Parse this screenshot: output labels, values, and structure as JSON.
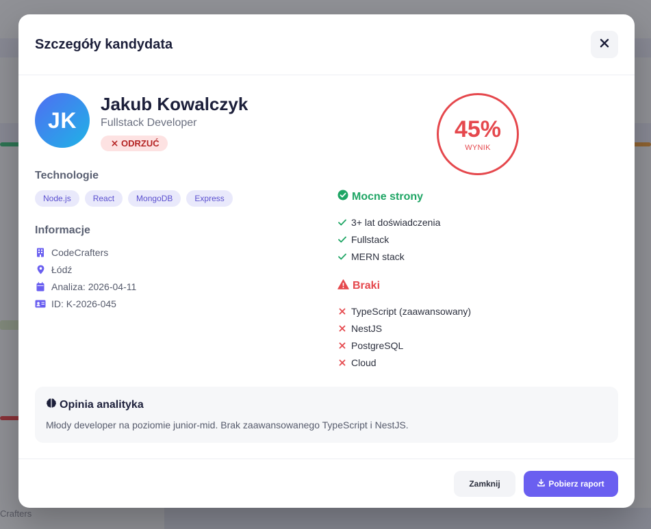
{
  "background": {
    "hint_texts": [
      "Crafters"
    ]
  },
  "modal": {
    "title": "Szczegóły kandydata",
    "close_icon": "close-icon"
  },
  "candidate": {
    "initials": "JK",
    "name": "Jakub Kowalczyk",
    "role": "Fullstack Developer",
    "status": "ODRZUĆ",
    "status_icon": "x-icon"
  },
  "technologies": {
    "title": "Technologie",
    "items": [
      "Node.js",
      "React",
      "MongoDB",
      "Express"
    ]
  },
  "info": {
    "title": "Informacje",
    "items": [
      {
        "icon": "building-icon",
        "text": "CodeCrafters"
      },
      {
        "icon": "map-pin-icon",
        "text": "Łódź"
      },
      {
        "icon": "calendar-icon",
        "text": "Analiza: 2026-04-11"
      },
      {
        "icon": "id-card-icon",
        "text": "ID: K-2026-045"
      }
    ]
  },
  "score": {
    "value": "45%",
    "label": "WYNIK"
  },
  "strengths": {
    "title": "Mocne strony",
    "items": [
      "3+ lat doświadczenia",
      "Fullstack",
      "MERN stack"
    ]
  },
  "gaps": {
    "title": "Braki",
    "items": [
      "TypeScript (zaawansowany)",
      "NestJS",
      "PostgreSQL",
      "Cloud"
    ]
  },
  "analyst": {
    "title": "Opinia analityka",
    "text": "Młody developer na poziomie junior-mid. Brak zaawansowanego TypeScript i NestJS."
  },
  "footer": {
    "close_label": "Zamknij",
    "download_label": "Pobierz raport"
  },
  "colors": {
    "accent": "#6a5ff0",
    "danger": "#e5484d",
    "success": "#1ea564",
    "avatar_from": "#4f6ef2",
    "avatar_to": "#1fb3e6"
  }
}
